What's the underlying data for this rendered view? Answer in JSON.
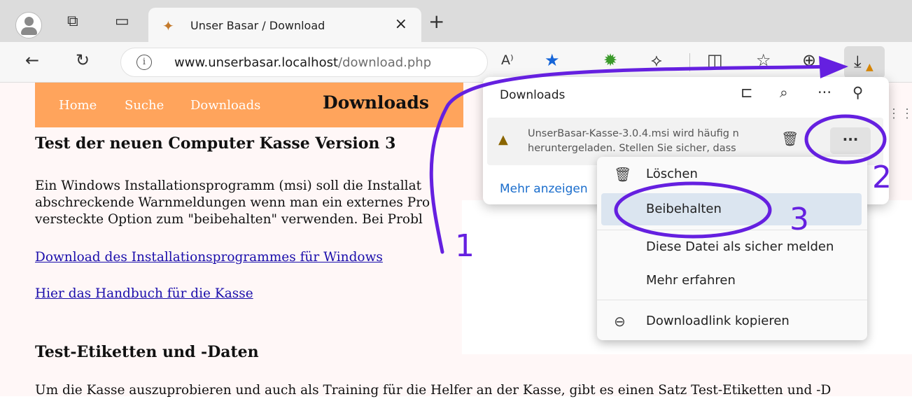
{
  "browser": {
    "tab": {
      "title": "Unser Basar / Download",
      "close": "×"
    },
    "new_tab": "+",
    "url_host": "www.unserbasar.localhost",
    "url_path": "/download.php",
    "read_aloud": "A⁾"
  },
  "page": {
    "nav": [
      "Home",
      "Suche",
      "Downloads"
    ],
    "title": "Downloads",
    "heading1": "Test der neuen Computer Kasse Version 3",
    "para_lines": [
      "Ein Windows Installationsprogramm (msi) soll die Installat",
      "abschreckende Warnmeldungen wenn man ein externes Pro",
      "versteckte Option zum \"beibehalten\" verwenden. Bei Probl"
    ],
    "link1": "Download des Installationsprogrammes für Windows",
    "link2": "Hier das Handbuch für die Kasse",
    "heading2": "Test-Etiketten und -Daten",
    "bottom_line": "Um die Kasse auszuprobieren und auch als Training für die Helfer an der Kasse, gibt es einen Satz Test-Etiketten und -D"
  },
  "downloads_panel": {
    "title": "Downloads",
    "item_line1": "UnserBasar-Kasse-3.0.4.msi wird häufig n",
    "item_line2": "heruntergeladen. Stellen Sie sicher, dass",
    "more_link": "Mehr anzeigen",
    "more_button": "···"
  },
  "context_menu": {
    "items": [
      "Löschen",
      "Beibehalten",
      "Diese Datei als sicher melden",
      "Mehr erfahren",
      "Downloadlink kopieren"
    ]
  },
  "annotations": {
    "labels": [
      "1",
      "2",
      "3"
    ],
    "color": "#6520e0"
  },
  "colors": {
    "header_orange": "#ffa45c",
    "link_blue": "#1a0dab",
    "highlight": "#dbe5f0"
  }
}
